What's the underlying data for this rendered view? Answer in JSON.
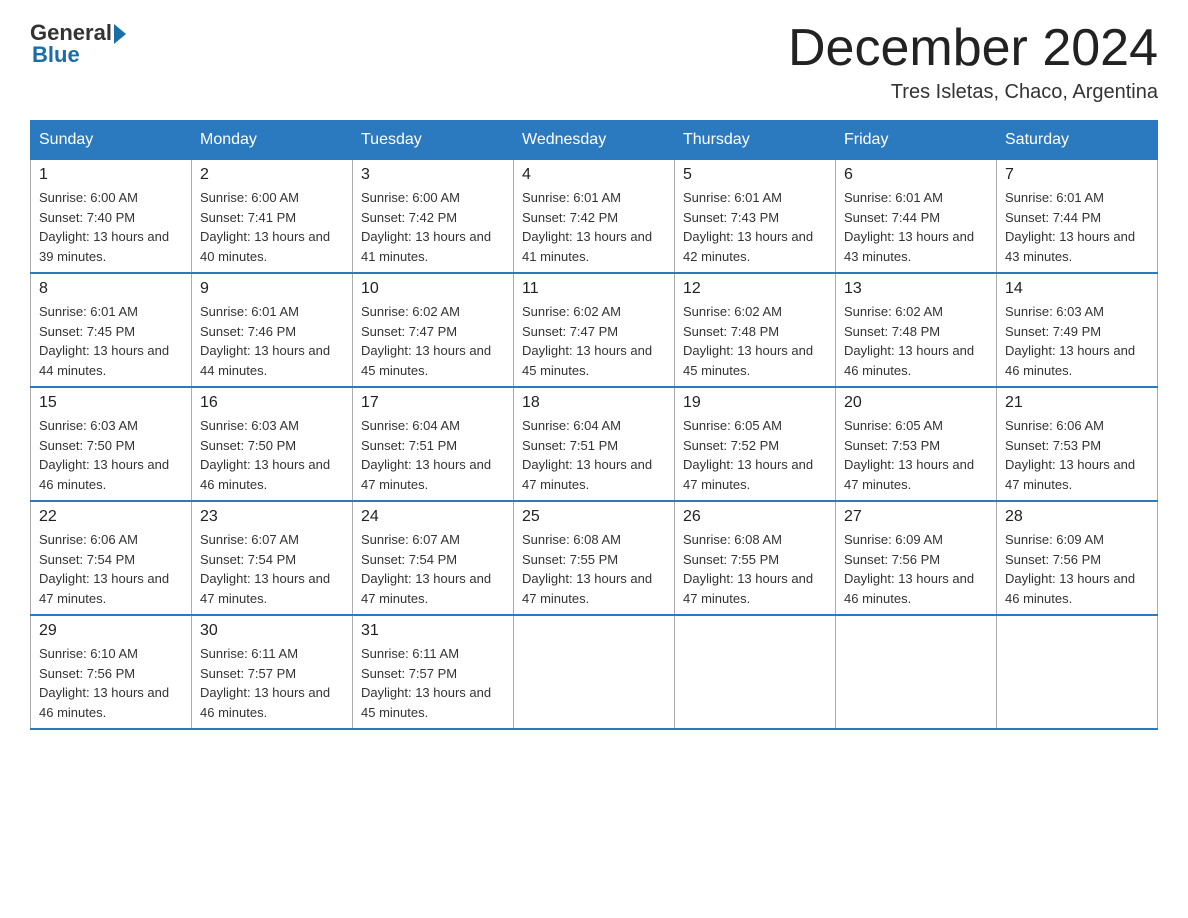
{
  "header": {
    "logo_general": "General",
    "logo_blue": "Blue",
    "month_title": "December 2024",
    "location": "Tres Isletas, Chaco, Argentina"
  },
  "days_of_week": [
    "Sunday",
    "Monday",
    "Tuesday",
    "Wednesday",
    "Thursday",
    "Friday",
    "Saturday"
  ],
  "weeks": [
    [
      {
        "day": "1",
        "sunrise": "6:00 AM",
        "sunset": "7:40 PM",
        "daylight": "13 hours and 39 minutes."
      },
      {
        "day": "2",
        "sunrise": "6:00 AM",
        "sunset": "7:41 PM",
        "daylight": "13 hours and 40 minutes."
      },
      {
        "day": "3",
        "sunrise": "6:00 AM",
        "sunset": "7:42 PM",
        "daylight": "13 hours and 41 minutes."
      },
      {
        "day": "4",
        "sunrise": "6:01 AM",
        "sunset": "7:42 PM",
        "daylight": "13 hours and 41 minutes."
      },
      {
        "day": "5",
        "sunrise": "6:01 AM",
        "sunset": "7:43 PM",
        "daylight": "13 hours and 42 minutes."
      },
      {
        "day": "6",
        "sunrise": "6:01 AM",
        "sunset": "7:44 PM",
        "daylight": "13 hours and 43 minutes."
      },
      {
        "day": "7",
        "sunrise": "6:01 AM",
        "sunset": "7:44 PM",
        "daylight": "13 hours and 43 minutes."
      }
    ],
    [
      {
        "day": "8",
        "sunrise": "6:01 AM",
        "sunset": "7:45 PM",
        "daylight": "13 hours and 44 minutes."
      },
      {
        "day": "9",
        "sunrise": "6:01 AM",
        "sunset": "7:46 PM",
        "daylight": "13 hours and 44 minutes."
      },
      {
        "day": "10",
        "sunrise": "6:02 AM",
        "sunset": "7:47 PM",
        "daylight": "13 hours and 45 minutes."
      },
      {
        "day": "11",
        "sunrise": "6:02 AM",
        "sunset": "7:47 PM",
        "daylight": "13 hours and 45 minutes."
      },
      {
        "day": "12",
        "sunrise": "6:02 AM",
        "sunset": "7:48 PM",
        "daylight": "13 hours and 45 minutes."
      },
      {
        "day": "13",
        "sunrise": "6:02 AM",
        "sunset": "7:48 PM",
        "daylight": "13 hours and 46 minutes."
      },
      {
        "day": "14",
        "sunrise": "6:03 AM",
        "sunset": "7:49 PM",
        "daylight": "13 hours and 46 minutes."
      }
    ],
    [
      {
        "day": "15",
        "sunrise": "6:03 AM",
        "sunset": "7:50 PM",
        "daylight": "13 hours and 46 minutes."
      },
      {
        "day": "16",
        "sunrise": "6:03 AM",
        "sunset": "7:50 PM",
        "daylight": "13 hours and 46 minutes."
      },
      {
        "day": "17",
        "sunrise": "6:04 AM",
        "sunset": "7:51 PM",
        "daylight": "13 hours and 47 minutes."
      },
      {
        "day": "18",
        "sunrise": "6:04 AM",
        "sunset": "7:51 PM",
        "daylight": "13 hours and 47 minutes."
      },
      {
        "day": "19",
        "sunrise": "6:05 AM",
        "sunset": "7:52 PM",
        "daylight": "13 hours and 47 minutes."
      },
      {
        "day": "20",
        "sunrise": "6:05 AM",
        "sunset": "7:53 PM",
        "daylight": "13 hours and 47 minutes."
      },
      {
        "day": "21",
        "sunrise": "6:06 AM",
        "sunset": "7:53 PM",
        "daylight": "13 hours and 47 minutes."
      }
    ],
    [
      {
        "day": "22",
        "sunrise": "6:06 AM",
        "sunset": "7:54 PM",
        "daylight": "13 hours and 47 minutes."
      },
      {
        "day": "23",
        "sunrise": "6:07 AM",
        "sunset": "7:54 PM",
        "daylight": "13 hours and 47 minutes."
      },
      {
        "day": "24",
        "sunrise": "6:07 AM",
        "sunset": "7:54 PM",
        "daylight": "13 hours and 47 minutes."
      },
      {
        "day": "25",
        "sunrise": "6:08 AM",
        "sunset": "7:55 PM",
        "daylight": "13 hours and 47 minutes."
      },
      {
        "day": "26",
        "sunrise": "6:08 AM",
        "sunset": "7:55 PM",
        "daylight": "13 hours and 47 minutes."
      },
      {
        "day": "27",
        "sunrise": "6:09 AM",
        "sunset": "7:56 PM",
        "daylight": "13 hours and 46 minutes."
      },
      {
        "day": "28",
        "sunrise": "6:09 AM",
        "sunset": "7:56 PM",
        "daylight": "13 hours and 46 minutes."
      }
    ],
    [
      {
        "day": "29",
        "sunrise": "6:10 AM",
        "sunset": "7:56 PM",
        "daylight": "13 hours and 46 minutes."
      },
      {
        "day": "30",
        "sunrise": "6:11 AM",
        "sunset": "7:57 PM",
        "daylight": "13 hours and 46 minutes."
      },
      {
        "day": "31",
        "sunrise": "6:11 AM",
        "sunset": "7:57 PM",
        "daylight": "13 hours and 45 minutes."
      },
      null,
      null,
      null,
      null
    ]
  ]
}
